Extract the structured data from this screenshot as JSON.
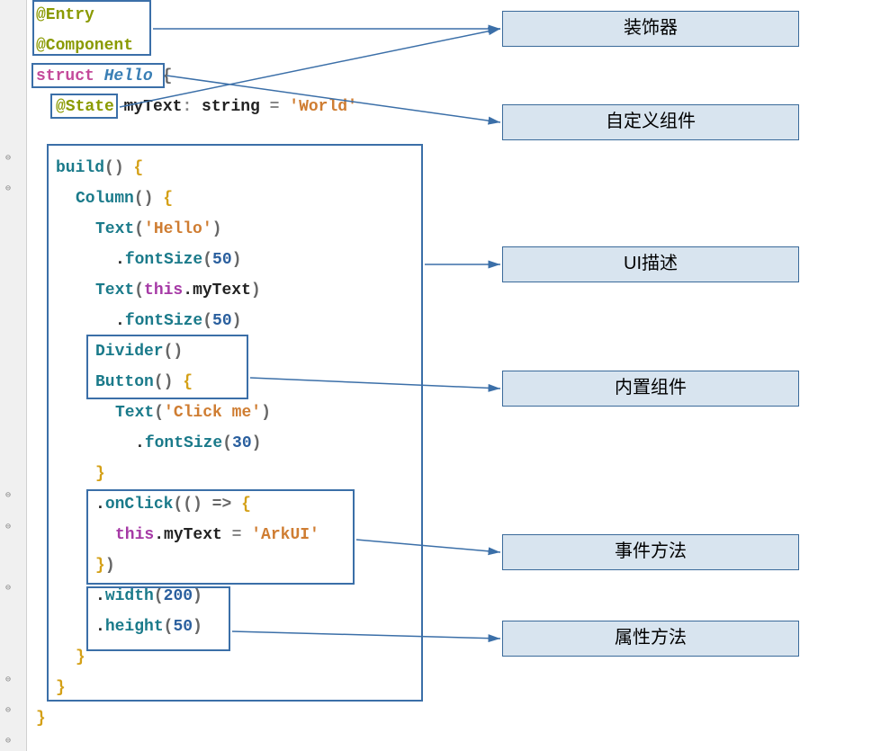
{
  "code": {
    "decorators": {
      "entry": "@Entry",
      "component": "@Component",
      "state": "@State"
    },
    "struct_kw": "struct",
    "struct_name": "Hello",
    "member_name": "myText",
    "member_type": "string",
    "member_init": "'World'",
    "build_fn": "build",
    "column_fn": "Column",
    "text_fn": "Text",
    "fontsize_fn": "fontSize",
    "divider_fn": "Divider",
    "button_fn": "Button",
    "onclick_fn": "onClick",
    "width_fn": "width",
    "height_fn": "height",
    "text_hello": "'Hello'",
    "text_click": "'Click me'",
    "assign_str": "'ArkUI'",
    "this_kw": "this",
    "fs50": "50",
    "fs30": "30",
    "w200": "200",
    "h50": "50"
  },
  "labels": {
    "decorator": "装饰器",
    "custom_component": "自定义组件",
    "ui_description": "UI描述",
    "builtin_component": "内置组件",
    "event_method": "事件方法",
    "attribute_method": "属性方法"
  }
}
